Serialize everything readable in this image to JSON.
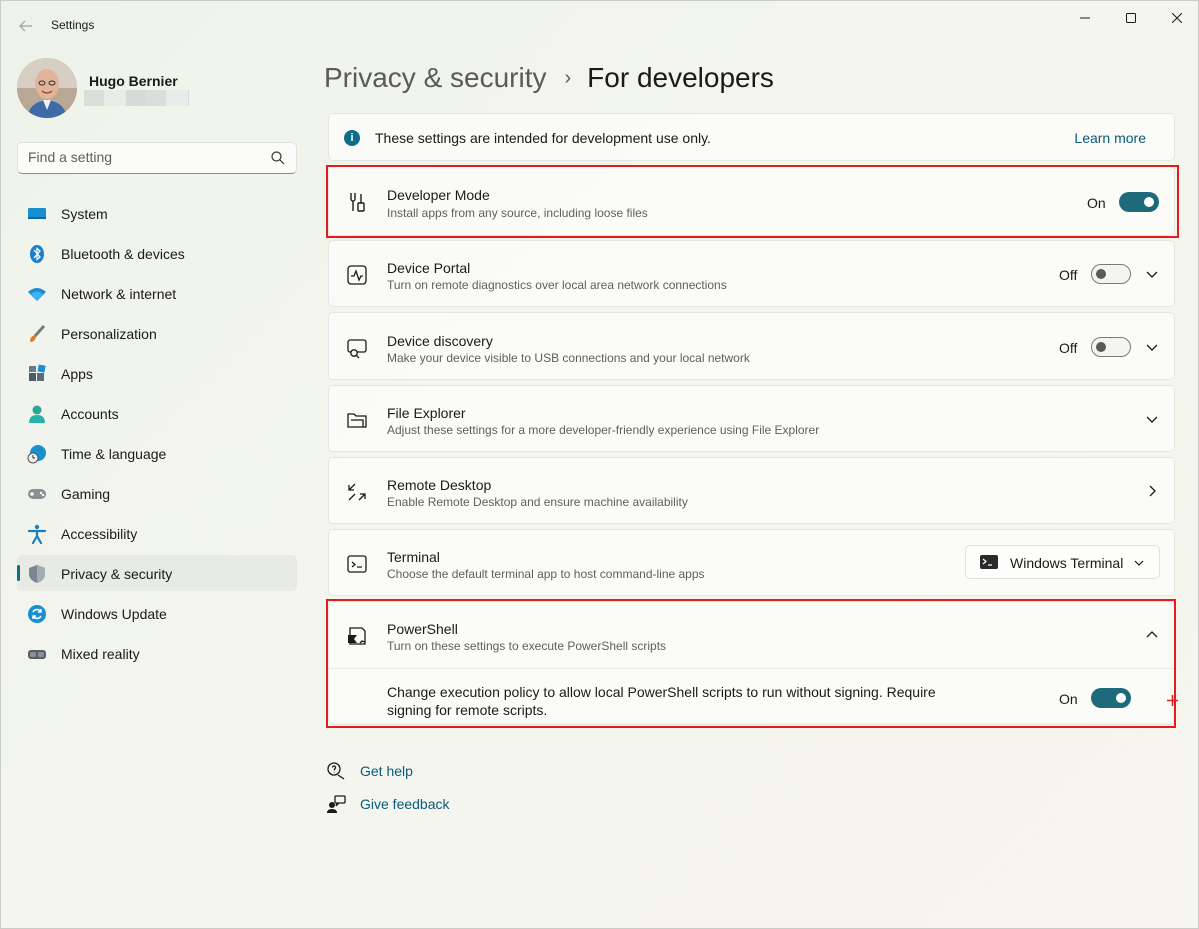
{
  "window": {
    "title": "Settings",
    "back_icon": "arrow-left-icon",
    "controls": [
      "minimize-icon",
      "maximize-icon",
      "close-icon"
    ]
  },
  "profile": {
    "name": "Hugo Bernier"
  },
  "search": {
    "placeholder": "Find a setting"
  },
  "sidebar": {
    "items": [
      {
        "label": "System",
        "icon": "monitor-icon",
        "active": false
      },
      {
        "label": "Bluetooth & devices",
        "icon": "bluetooth-icon",
        "active": false
      },
      {
        "label": "Network & internet",
        "icon": "wifi-icon",
        "active": false
      },
      {
        "label": "Personalization",
        "icon": "paintbrush-icon",
        "active": false
      },
      {
        "label": "Apps",
        "icon": "apps-icon",
        "active": false
      },
      {
        "label": "Accounts",
        "icon": "person-icon",
        "active": false
      },
      {
        "label": "Time & language",
        "icon": "globe-clock-icon",
        "active": false
      },
      {
        "label": "Gaming",
        "icon": "gamepad-icon",
        "active": false
      },
      {
        "label": "Accessibility",
        "icon": "accessibility-icon",
        "active": false
      },
      {
        "label": "Privacy & security",
        "icon": "shield-icon",
        "active": true
      },
      {
        "label": "Windows Update",
        "icon": "refresh-icon",
        "active": false
      },
      {
        "label": "Mixed reality",
        "icon": "headset-icon",
        "active": false
      }
    ]
  },
  "breadcrumb": {
    "parent": "Privacy & security",
    "separator": "›",
    "current": "For developers"
  },
  "info_bar": {
    "text": "These settings are intended for development use only.",
    "link": "Learn more"
  },
  "settings": {
    "developer_mode": {
      "title": "Developer Mode",
      "desc": "Install apps from any source, including loose files",
      "state": "On"
    },
    "device_portal": {
      "title": "Device Portal",
      "desc": "Turn on remote diagnostics over local area network connections",
      "state": "Off"
    },
    "device_discovery": {
      "title": "Device discovery",
      "desc": "Make your device visible to USB connections and your local network",
      "state": "Off"
    },
    "file_explorer": {
      "title": "File Explorer",
      "desc": "Adjust these settings for a more developer-friendly experience using File Explorer"
    },
    "remote_desktop": {
      "title": "Remote Desktop",
      "desc": "Enable Remote Desktop and ensure machine availability"
    },
    "terminal": {
      "title": "Terminal",
      "desc": "Choose the default terminal app to host command-line apps",
      "selected": "Windows Terminal"
    },
    "powershell": {
      "title": "PowerShell",
      "desc": "Turn on these settings to execute PowerShell scripts",
      "sub_text": "Change execution policy to allow local PowerShell scripts to run without signing. Require signing for remote scripts.",
      "state": "On"
    }
  },
  "footer": {
    "help": "Get help",
    "feedback": "Give feedback"
  },
  "colors": {
    "accent": "#1e6a7a",
    "link": "#0b5a7a",
    "highlight": "#e01e1e"
  }
}
